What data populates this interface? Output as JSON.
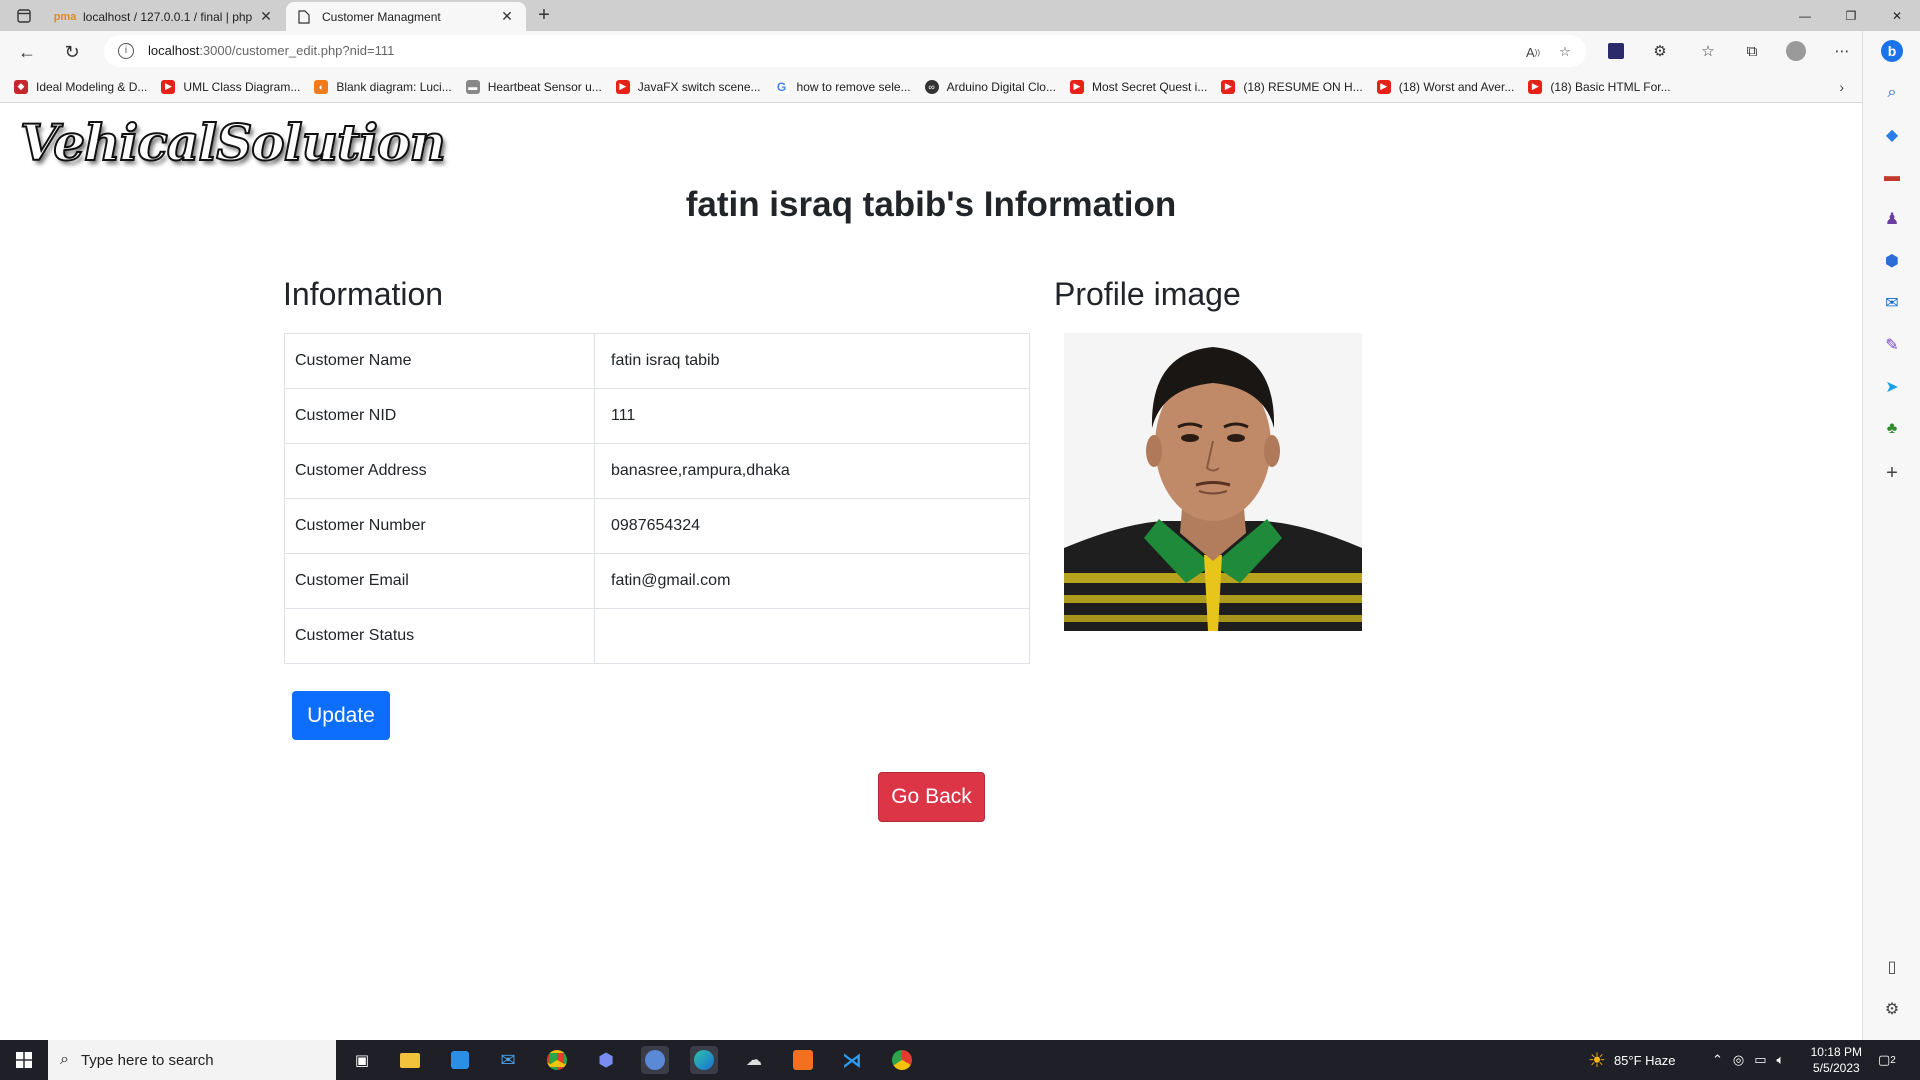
{
  "browser": {
    "tabs": [
      {
        "label": "localhost / 127.0.0.1 / final | php",
        "active": false
      },
      {
        "label": "Customer Managment",
        "active": true
      }
    ],
    "url_host": "localhost",
    "url_path": ":3000/customer_edit.php?nid=111",
    "bookmarks": [
      "Ideal Modeling & D...",
      "UML Class Diagram...",
      "Blank diagram: Luci...",
      "Heartbeat Sensor u...",
      "JavaFX switch scene...",
      "how to remove sele...",
      "Arduino Digital Clo...",
      "Most Secret Quest i...",
      "(18) RESUME ON H...",
      "(18) Worst and Aver...",
      "(18) Basic HTML For..."
    ]
  },
  "page": {
    "logo": "VehicalSolution",
    "title": "fatin israq tabib's Information",
    "info_heading": "Information",
    "profile_heading": "Profile image",
    "fields": [
      {
        "label": "Customer Name",
        "value": "fatin israq tabib"
      },
      {
        "label": "Customer NID",
        "value": "111"
      },
      {
        "label": "Customer Address",
        "value": "banasree,rampura,dhaka"
      },
      {
        "label": "Customer Number",
        "value": "0987654324"
      },
      {
        "label": "Customer Email",
        "value": "fatin@gmail.com"
      },
      {
        "label": "Customer Status",
        "value": ""
      }
    ],
    "update_label": "Update",
    "back_label": "Go Back"
  },
  "taskbar": {
    "search_placeholder": "Type here to search",
    "weather": "85°F  Haze",
    "time": "10:18 PM",
    "date": "5/5/2023",
    "notifications": "2"
  },
  "colors": {
    "primary": "#0d6efd",
    "danger": "#dc3545",
    "taskbar": "#1f2027"
  }
}
